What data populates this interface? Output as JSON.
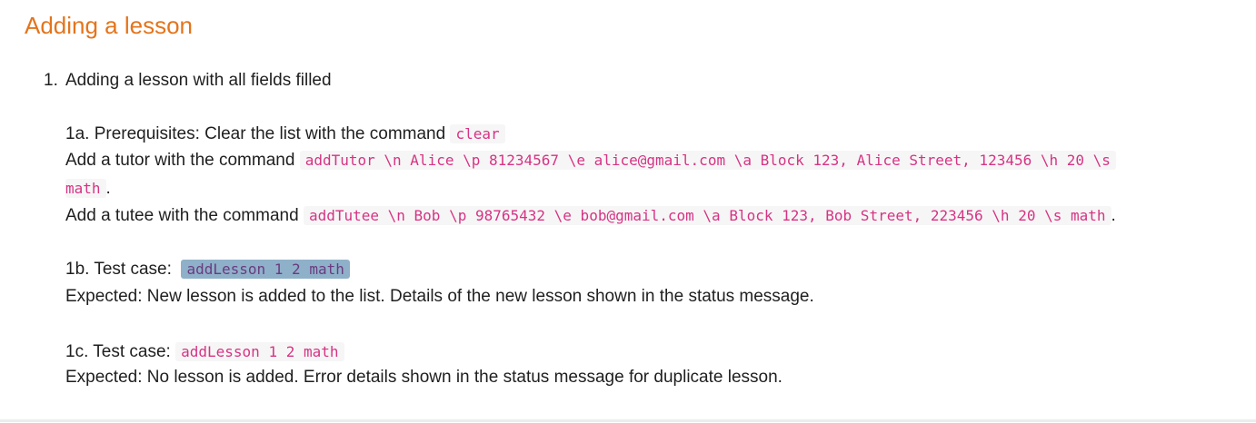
{
  "section": {
    "title": "Adding a lesson"
  },
  "step": {
    "number": "1.",
    "title": "Adding a lesson with all fields filled"
  },
  "prereq": {
    "label": "1a. Prerequisites: Clear the list with the command",
    "clear_cmd": "clear",
    "tutor_label": "Add a tutor with the command",
    "tutor_cmd_part1": "addTutor \\n Alice \\p 81234567 \\e alice@gmail.com \\a Block 123, Alice Street, 123456 \\h 20 \\s",
    "tutor_cmd_part2": "math",
    "tutor_end": ".",
    "tutee_label": "Add a tutee with the command",
    "tutee_cmd": "addTutee \\n Bob \\p 98765432 \\e bob@gmail.com \\a Block 123, Bob Street, 223456 \\h 20 \\s math",
    "tutee_end": "."
  },
  "test_b": {
    "label": "1b. Test case:",
    "cmd": "addLesson 1 2 math",
    "expected": "Expected: New lesson is added to the list. Details of the new lesson shown in the status message."
  },
  "test_c": {
    "label": "1c. Test case:",
    "cmd": "addLesson 1 2 math",
    "expected": "Expected: No lesson is added. Error details shown in the status message for duplicate lesson."
  }
}
